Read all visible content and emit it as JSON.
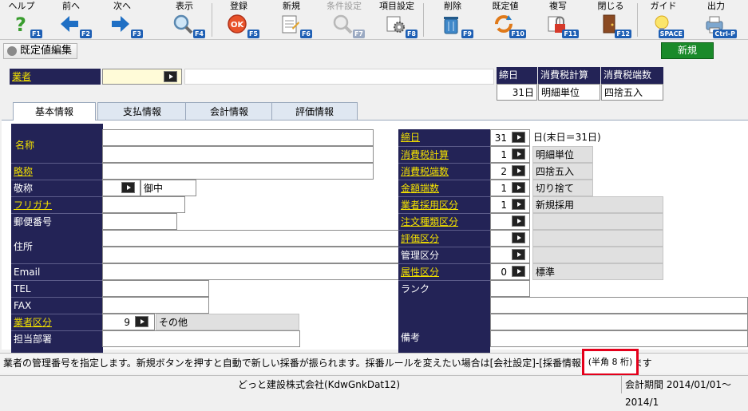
{
  "toolbar": {
    "help": {
      "label": "ヘルプ",
      "key": "F1"
    },
    "prev": {
      "label": "前へ",
      "key": "F2"
    },
    "next": {
      "label": "次へ",
      "key": "F3"
    },
    "view": {
      "label": "表示",
      "key": "F4"
    },
    "register": {
      "label": "登録",
      "key": "F5"
    },
    "new": {
      "label": "新規",
      "key": "F6"
    },
    "condition": {
      "label": "条件設定",
      "key": "F7"
    },
    "item_setting": {
      "label": "項目設定",
      "key": "F8"
    },
    "delete": {
      "label": "削除",
      "key": "F9"
    },
    "default": {
      "label": "既定値",
      "key": "F10"
    },
    "copy": {
      "label": "複写",
      "key": "F11"
    },
    "close": {
      "label": "閉じる",
      "key": "F12"
    },
    "guide": {
      "label": "ガイド",
      "key": "SPACE"
    },
    "output": {
      "label": "出力",
      "key": "Ctrl-P"
    }
  },
  "title_button": "既定値編集",
  "new_button": "新規",
  "vendor": {
    "label": "業者",
    "value": ""
  },
  "summary_table": {
    "headers": [
      "締日",
      "消費税計算",
      "消費税端数"
    ],
    "values": [
      "31日",
      "明細単位",
      "四捨五入"
    ]
  },
  "tabs": [
    "基本情報",
    "支払情報",
    "会計情報",
    "評価情報"
  ],
  "left_fields": {
    "name": "名称",
    "short_name": "略称",
    "honorific": "敬称",
    "honorific_value": "御中",
    "furigana": "フリガナ",
    "postal": "郵便番号",
    "address": "住所",
    "email": "Email",
    "tel": "TEL",
    "fax": "FAX",
    "vendor_class": "業者区分",
    "vendor_class_code": "9",
    "vendor_class_value": "その他",
    "department": "担当部署"
  },
  "right_fields": {
    "closing_day": {
      "label": "締日",
      "code": "31",
      "value": "日(末日＝31日)"
    },
    "tax_calc": {
      "label": "消費税計算",
      "code": "1",
      "value": "明細単位"
    },
    "tax_rounding": {
      "label": "消費税端数",
      "code": "2",
      "value": "四捨五入"
    },
    "amount_rounding": {
      "label": "金額端数",
      "code": "1",
      "value": "切り捨て"
    },
    "adoption": {
      "label": "業者採用区分",
      "code": "1",
      "value": "新規採用"
    },
    "order_type": {
      "label": "注文種類区分",
      "code": "",
      "value": ""
    },
    "evaluation": {
      "label": "評価区分",
      "code": "",
      "value": ""
    },
    "management": {
      "label": "管理区分",
      "code": "",
      "value": ""
    },
    "attribute": {
      "label": "属性区分",
      "code": "0",
      "value": "標準"
    },
    "rank": {
      "label": "ランク"
    },
    "remarks": {
      "label": "備考"
    }
  },
  "status_message": "業者の管理番号を指定します。新規ボタンを押すと自動で新しい採番が振られます。採番ルールを変えたい場合は[会社設定]-[採番情報]で設定できます",
  "status_hint": "(半角 8 桁)",
  "footer": {
    "company": "どっと建設株式会社(KdwGnkDat12)",
    "period": "会計期間 2014/01/01～2014/1"
  },
  "colors": {
    "navy": "#232356",
    "link_yellow": "#f2e000",
    "new_green": "#1a8a2a",
    "highlight_red": "#e4001b"
  }
}
